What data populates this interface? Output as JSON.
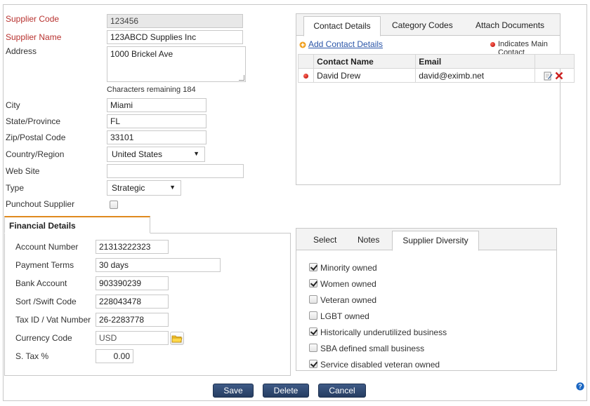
{
  "supplier": {
    "code_label": "Supplier Code",
    "code_value": "123456",
    "name_label": "Supplier Name",
    "name_value": "123ABCD Supplies Inc",
    "address_label": "Address",
    "address_value": "1000 Brickel Ave",
    "chars_remaining": "Characters remaining 184",
    "city_label": "City",
    "city_value": "Miami",
    "state_label": "State/Province",
    "state_value": "FL",
    "zip_label": "Zip/Postal Code",
    "zip_value": "33101",
    "country_label": "Country/Region",
    "country_value": "United States",
    "website_label": "Web Site",
    "website_value": "",
    "type_label": "Type",
    "type_value": "Strategic",
    "punchout_label": "Punchout Supplier",
    "punchout_checked": false
  },
  "financial": {
    "tab_label": "Financial Details",
    "account_label": "Account Number",
    "account_value": "21313222323",
    "terms_label": "Payment Terms",
    "terms_value": "30 days",
    "bank_label": "Bank Account",
    "bank_value": "903390239",
    "sort_label": "Sort /Swift Code",
    "sort_value": "228043478",
    "tax_label": "Tax ID / Vat Number",
    "tax_value": "26-2283778",
    "currency_label": "Currency Code",
    "currency_value": "USD",
    "stax_label": "S. Tax %",
    "stax_value": "0.00"
  },
  "contact_panel": {
    "tabs": [
      "Contact Details",
      "Category Codes",
      "Attach Documents"
    ],
    "add_link": "Add Contact Details",
    "main_contact_note": "Indicates Main Contact",
    "columns": [
      "Contact Name",
      "Email"
    ],
    "rows": [
      {
        "name": "David Drew",
        "email": "david@eximb.net",
        "main": true
      }
    ]
  },
  "diversity_panel": {
    "tabs": [
      "Select",
      "Notes",
      "Supplier Diversity"
    ],
    "items": [
      {
        "label": "Minority owned",
        "checked": true
      },
      {
        "label": "Women owned",
        "checked": true
      },
      {
        "label": "Veteran owned",
        "checked": false
      },
      {
        "label": "LGBT owned",
        "checked": false
      },
      {
        "label": "Historically underutilized business",
        "checked": true
      },
      {
        "label": "SBA defined small business",
        "checked": false
      },
      {
        "label": "Service disabled veteran owned",
        "checked": true
      }
    ]
  },
  "actions": {
    "save": "Save",
    "delete": "Delete",
    "cancel": "Cancel"
  },
  "colors": {
    "required_label": "#b8322f",
    "button_bg": "#2f4a74",
    "add_icon": "#f0a020",
    "delete_icon": "#cc1f1f",
    "help_icon": "#1a66c2"
  },
  "icons": {
    "add": "plus-circle-icon",
    "edit": "edit-note-icon",
    "delete": "red-x-icon",
    "folder": "folder-icon",
    "help": "help-icon",
    "main_contact": "red-dot-icon"
  }
}
